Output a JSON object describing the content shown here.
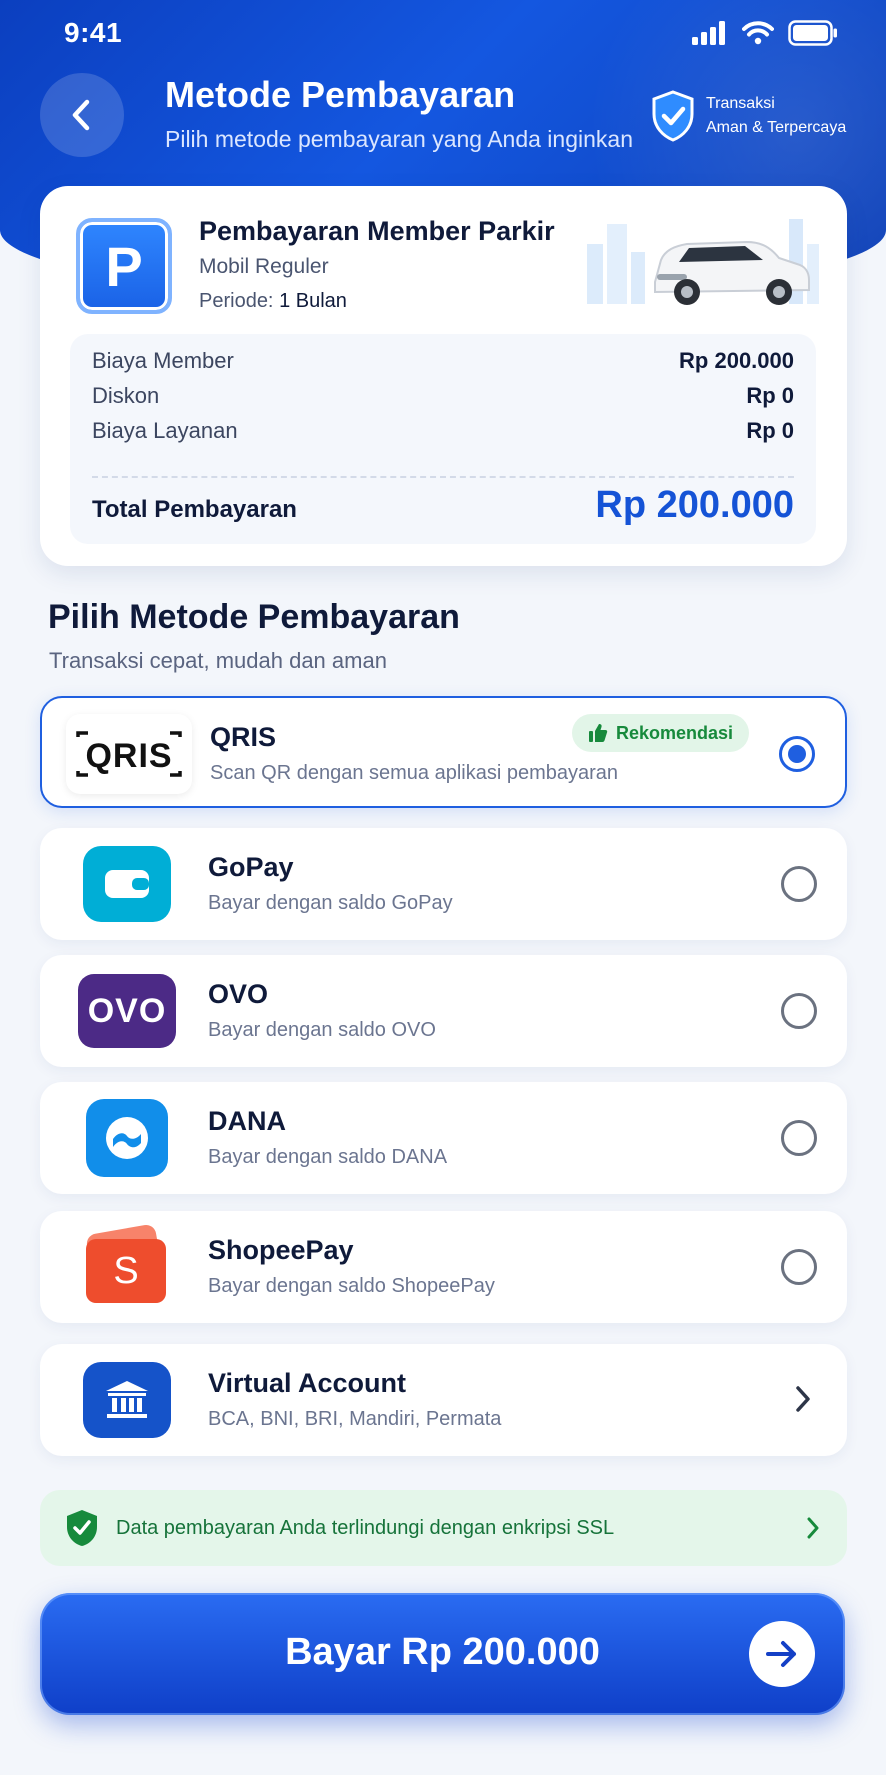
{
  "status_bar": {
    "time": "9:41"
  },
  "header": {
    "title": "Metode Pembayaran",
    "subtitle": "Pilih metode pembayaran yang Anda inginkan",
    "trust_line1": "Transaksi",
    "trust_line2": "Aman & Terpercaya"
  },
  "summary": {
    "title": "Pembayaran Member Parkir",
    "vehicle": "Mobil Reguler",
    "period_label": "Periode:",
    "period_value": "1 Bulan",
    "fees": [
      {
        "label": "Biaya Member",
        "value": "Rp 200.000"
      },
      {
        "label": "Diskon",
        "value": "Rp 0"
      },
      {
        "label": "Biaya Layanan",
        "value": "Rp 0"
      }
    ],
    "total_label": "Total Pembayaran",
    "total_value": "Rp 200.000"
  },
  "methods_section": {
    "title": "Pilih Metode Pembayaran",
    "subtitle": "Transaksi cepat, mudah dan aman"
  },
  "methods": [
    {
      "name": "QRIS",
      "desc": "Scan QR dengan semua aplikasi pembayaran",
      "badge": "Rekomendasi",
      "selected": true,
      "icon": "qris-logo"
    },
    {
      "name": "GoPay",
      "desc": "Bayar dengan saldo GoPay",
      "selected": false,
      "icon": "gopay-wallet-icon"
    },
    {
      "name": "OVO",
      "desc": "Bayar dengan saldo OVO",
      "logo_text": "OVO",
      "selected": false,
      "icon": "ovo-logo"
    },
    {
      "name": "DANA",
      "desc": "Bayar dengan saldo DANA",
      "selected": false,
      "icon": "dana-logo"
    },
    {
      "name": "ShopeePay",
      "desc": "Bayar dengan saldo ShopeePay",
      "logo_text": "S",
      "selected": false,
      "icon": "shopeepay-bag-icon"
    },
    {
      "name": "Virtual Account",
      "desc": "BCA, BNI, BRI, Mandiri, Permata",
      "icon": "bank-icon"
    }
  ],
  "qris_logo_text": "QRIS",
  "ssl_notice": "Data pembayaran Anda terlindungi dengan enkripsi SSL",
  "pay_button": {
    "label": "Bayar Rp 200.000"
  },
  "colors": {
    "primary": "#1553d6",
    "success": "#178a3c",
    "ovo": "#4c2a86",
    "gopay": "#00aed6",
    "dana": "#118eea",
    "shopee": "#ee4d2d"
  }
}
